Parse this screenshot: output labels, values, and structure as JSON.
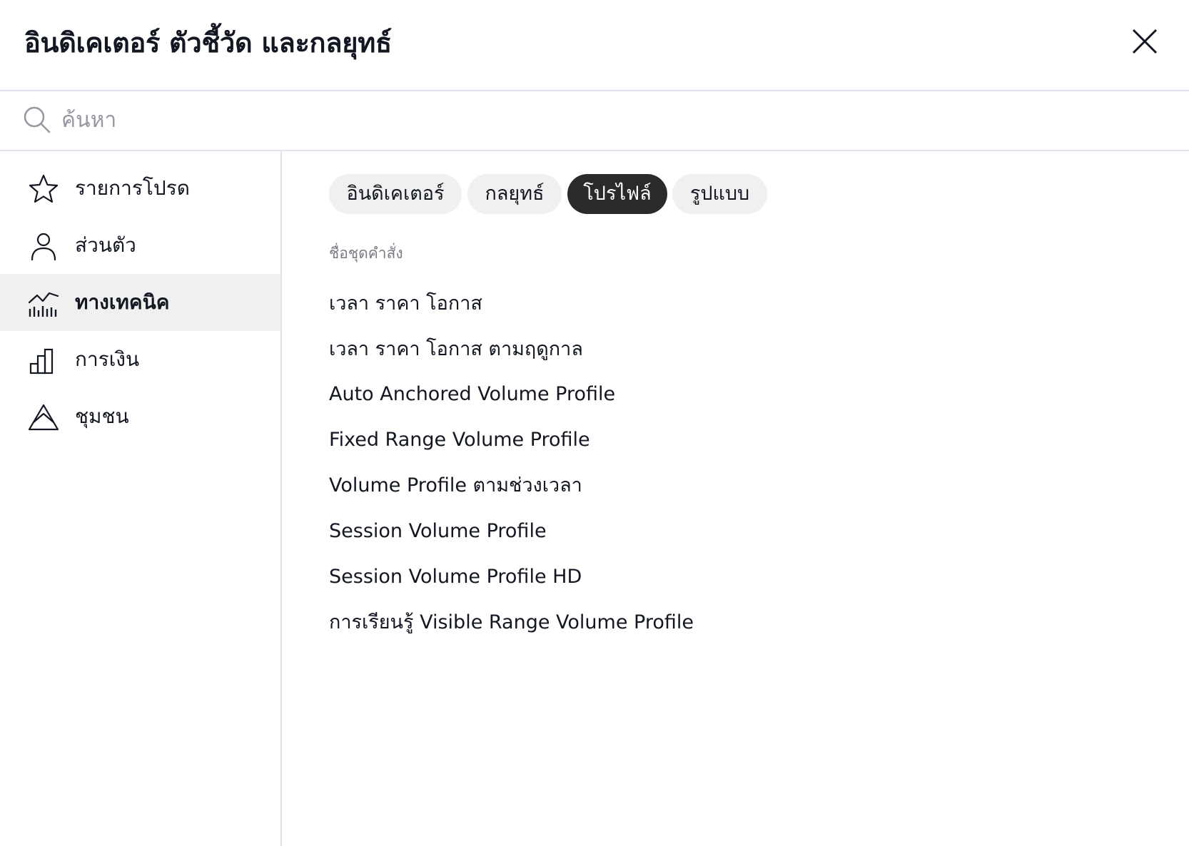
{
  "dialog": {
    "title": "อินดิเคเตอร์ ตัวชี้วัด และกลยุทธ์"
  },
  "search": {
    "placeholder": "ค้นหา",
    "value": ""
  },
  "sidebar": {
    "items": [
      {
        "label": "รายการโปรด",
        "icon": "star-icon",
        "active": false
      },
      {
        "label": "ส่วนตัว",
        "icon": "user-icon",
        "active": false
      },
      {
        "label": "ทางเทคนิค",
        "icon": "technical-chart-icon",
        "active": true
      },
      {
        "label": "การเงิน",
        "icon": "bar-chart-icon",
        "active": false
      },
      {
        "label": "ชุมชน",
        "icon": "community-mountain-icon",
        "active": false
      }
    ]
  },
  "tabs": [
    {
      "label": "อินดิเคเตอร์",
      "active": false
    },
    {
      "label": "กลยุทธ์",
      "active": false
    },
    {
      "label": "โปรไฟล์",
      "active": true
    },
    {
      "label": "รูปแบบ",
      "active": false
    }
  ],
  "list": {
    "header": "ชื่อชุดคำสั่ง",
    "items": [
      "เวลา ราคา โอกาส",
      "เวลา ราคา โอกาส ตามฤดูกาล",
      "Auto Anchored Volume Profile",
      "Fixed Range Volume Profile",
      "Volume Profile ตามช่วงเวลา",
      "Session Volume Profile",
      "Session Volume Profile HD",
      "การเรียนรู้ Visible Range Volume Profile"
    ]
  },
  "colors": {
    "active_tab_bg": "#2a2a2a",
    "tab_bg": "#f0f0f0",
    "active_sidebar_bg": "#f0f0f0",
    "divider": "#e0e3eb",
    "muted_text": "#787b86",
    "text": "#131722"
  }
}
